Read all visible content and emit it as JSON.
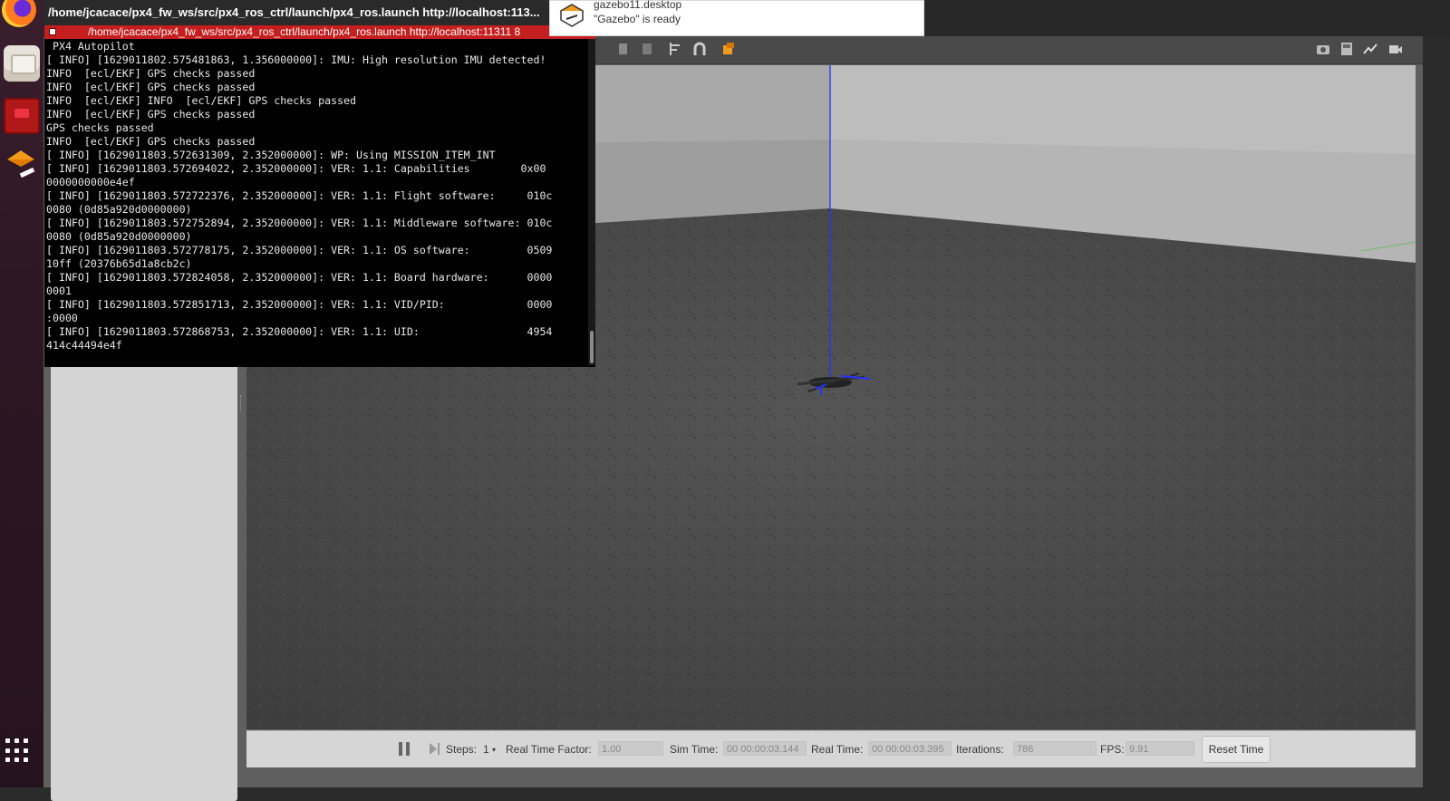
{
  "terminal": {
    "title": "/home/jcacace/px4_fw_ws/src/px4_ros_ctrl/launch/px4_ros.launch http://localhost:113...",
    "minimize_glyph": "–",
    "tab_label": "/home/jcacace/px4_fw_ws/src/px4_ros_ctrl/launch/px4_ros.launch http://localhost:11311 8",
    "lines": [
      " PX4 Autopilot",
      "[ INFO] [1629011802.575481863, 1.356000000]: IMU: High resolution IMU detected!",
      "INFO  [ecl/EKF] GPS checks passed",
      "INFO  [ecl/EKF] GPS checks passed",
      "INFO  [ecl/EKF] INFO  [ecl/EKF] GPS checks passed",
      "INFO  [ecl/EKF] GPS checks passed",
      "GPS checks passed",
      "INFO  [ecl/EKF] GPS checks passed",
      "[ INFO] [1629011803.572631309, 2.352000000]: WP: Using MISSION_ITEM_INT",
      "[ INFO] [1629011803.572694022, 2.352000000]: VER: 1.1: Capabilities        0x00",
      "0000000000e4ef",
      "[ INFO] [1629011803.572722376, 2.352000000]: VER: 1.1: Flight software:     010c",
      "0080 (0d85a920d0000000)",
      "[ INFO] [1629011803.572752894, 2.352000000]: VER: 1.1: Middleware software: 010c",
      "0080 (0d85a920d0000000)",
      "[ INFO] [1629011803.572778175, 2.352000000]: VER: 1.1: OS software:         0509",
      "10ff (20376b65d1a8cb2c)",
      "[ INFO] [1629011803.572824058, 2.352000000]: VER: 1.1: Board hardware:      0000",
      "0001",
      "[ INFO] [1629011803.572851713, 2.352000000]: VER: 1.1: VID/PID:             0000",
      ":0000",
      "[ INFO] [1629011803.572868753, 2.352000000]: VER: 1.1: UID:                 4954",
      "414c44494e4f"
    ]
  },
  "notification": {
    "title": "gazebo11.desktop",
    "body": "\"Gazebo\" is ready"
  },
  "gazebo": {
    "bottom_bar": {
      "steps_label": "Steps:",
      "steps_value": "1",
      "rtf_label": "Real Time Factor:",
      "rtf_value": "1.00",
      "sim_time_label": "Sim Time:",
      "sim_time_value": "00 00:00:03.144",
      "real_time_label": "Real Time:",
      "real_time_value": "00 00:00:03.395",
      "iterations_label": "Iterations:",
      "iterations_value": "786",
      "fps_label": "FPS:",
      "fps_value": "9.91",
      "reset_label": "Reset Time"
    }
  },
  "dock": {
    "icons": [
      "firefox-icon",
      "files-icon",
      "rviz-icon",
      "gazebo-icon",
      "apps-grid-icon"
    ]
  },
  "colors": {
    "terminal_tab": "#c41e1e",
    "gazebo_accent": "#f29a1a",
    "z_axis": "#2233ff"
  }
}
